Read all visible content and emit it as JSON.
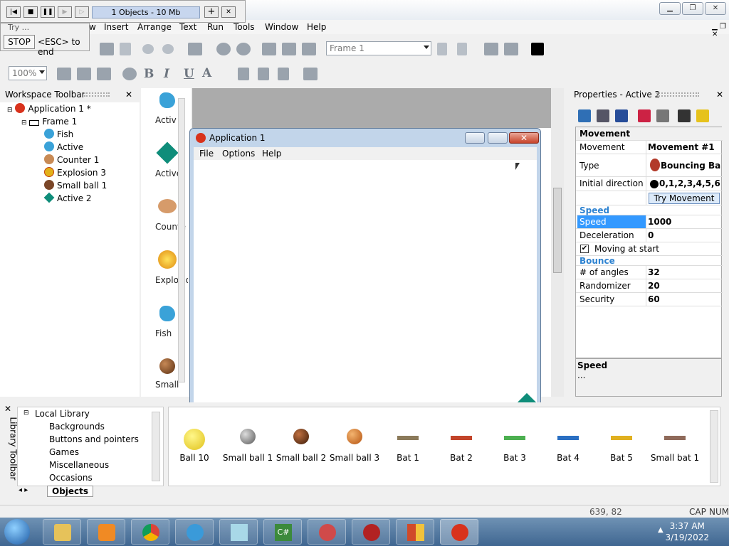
{
  "titlebar": {
    "min": "▁",
    "max": "❐",
    "close": "✕"
  },
  "menu": {
    "items": [
      "Insert",
      "Arrange",
      "Text",
      "Run",
      "Tools",
      "Window",
      "Help"
    ],
    "partial_first": "w"
  },
  "trybar": {
    "info": "1 Objects - 10 Mb",
    "label": "Try ...",
    "plus": "+",
    "close": "✕"
  },
  "stopbar": {
    "stop": "STOP",
    "hint": "<ESC> to end"
  },
  "toolbar": {
    "frame_combo": "Frame 1",
    "zoom_combo": "100%"
  },
  "workspace": {
    "title": "Workspace Toolbar",
    "app": "Application 1 *",
    "frame": "Frame 1",
    "items": [
      "Fish",
      "Active",
      "Counter 1",
      "Explosion 3",
      "Small ball 1",
      "Active 2"
    ]
  },
  "library_panel": {
    "items": [
      "Activ",
      "Active",
      "Counte",
      "Explosio",
      "Fish",
      "Small"
    ]
  },
  "appwin": {
    "title": "Application 1",
    "menu": [
      "File",
      "Options",
      "Help"
    ]
  },
  "properties": {
    "title": "Properties - Active 2",
    "section_movement": "Movement",
    "rows": [
      {
        "k": "Movement",
        "v": "Movement #1"
      },
      {
        "k": "Type",
        "v": "Bouncing Ba"
      },
      {
        "k": "Initial direction",
        "v": "0,1,2,3,4,5,6"
      }
    ],
    "try_btn": "Try Movement",
    "speed_section": "Speed",
    "speed_rows": [
      {
        "k": "Speed",
        "v": "1000"
      },
      {
        "k": "Deceleration",
        "v": "0"
      }
    ],
    "moving_at_start": "Moving at start",
    "bounce_section": "Bounce",
    "bounce_rows": [
      {
        "k": "# of angles",
        "v": "32"
      },
      {
        "k": "Randomizer",
        "v": "20"
      },
      {
        "k": "Security",
        "v": "60"
      }
    ],
    "help_title": "Speed",
    "help_text": "..."
  },
  "library": {
    "side_label": "Library Toolbar",
    "tree_root": "Local Library",
    "tree_items": [
      "Backgrounds",
      "Buttons and pointers",
      "Games",
      "Miscellaneous",
      "Occasions"
    ],
    "tab": "Objects",
    "objects": [
      "Ball 10",
      "Small ball 1",
      "Small ball 2",
      "Small ball 3",
      "Bat 1",
      "Bat 2",
      "Bat 3",
      "Bat 4",
      "Bat 5",
      "Small bat 1"
    ]
  },
  "status": {
    "coords": "639, 82",
    "caps": "CAP",
    "num": "NUM"
  },
  "taskbar": {
    "time": "3:37 AM",
    "date": "3/19/2022"
  }
}
